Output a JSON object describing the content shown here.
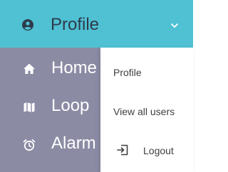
{
  "header": {
    "title": "Profile",
    "icon": "user-circle-icon",
    "toggle_icon": "chevron-down-icon"
  },
  "sidebar": {
    "items": [
      {
        "label": "Home",
        "icon": "home-icon"
      },
      {
        "label": "Loop",
        "icon": "map-icon"
      },
      {
        "label": "Alarm",
        "icon": "alarm-clock-icon"
      }
    ]
  },
  "dropdown": {
    "items": [
      {
        "label": "Profile"
      },
      {
        "label": "View all users"
      },
      {
        "label": "Logout",
        "icon": "logout-icon"
      }
    ]
  },
  "colors": {
    "header_bg": "#4fc1d3",
    "sidebar_bg": "#8b8ba4",
    "dropdown_bg": "#ffffff",
    "header_text": "#2e3a4a",
    "nav_text": "#ffffff",
    "menu_text": "#3f3f3f"
  }
}
